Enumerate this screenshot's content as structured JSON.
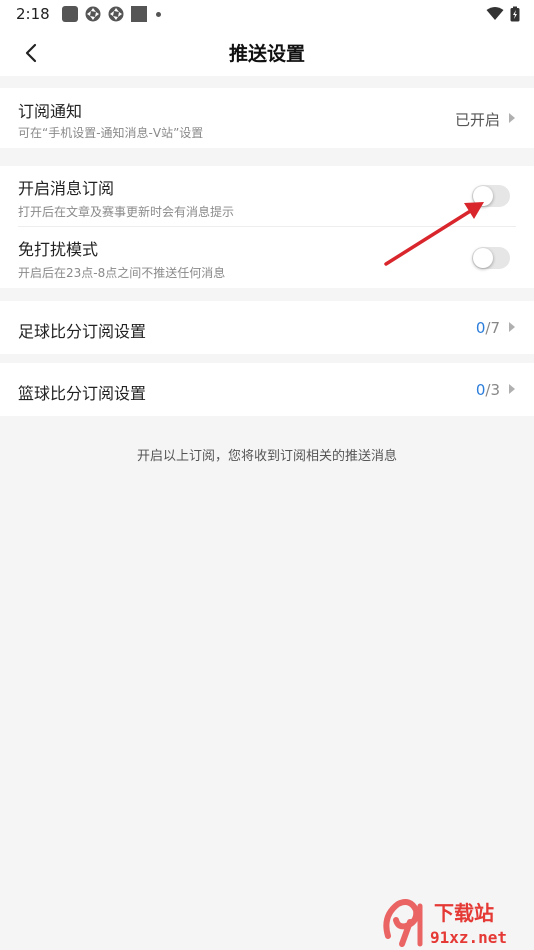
{
  "status_bar": {
    "time": "2:18"
  },
  "header": {
    "title": "推送设置"
  },
  "subscription_notice": {
    "title": "订阅通知",
    "subtitle": "可在“手机设置-通知消息-V站”设置",
    "status": "已开启"
  },
  "message_subscription": {
    "title": "开启消息订阅",
    "subtitle": "打开后在文章及赛事更新时会有消息提示",
    "enabled": false
  },
  "do_not_disturb": {
    "title": "免打扰模式",
    "subtitle": "开启后在23点-8点之间不推送任何消息",
    "enabled": false
  },
  "football": {
    "title": "足球比分订阅设置",
    "current": "0",
    "total": "/7"
  },
  "basketball": {
    "title": "篮球比分订阅设置",
    "current": "0",
    "total": "/3"
  },
  "footer_note": "开启以上订阅，您将收到订阅相关的推送消息",
  "watermark": {
    "text": "91xz.net",
    "brand": "下载站"
  },
  "colors": {
    "accent": "#2b7ddb",
    "toggle_off": "#e6e6e6",
    "arrow": "#d9262c"
  }
}
